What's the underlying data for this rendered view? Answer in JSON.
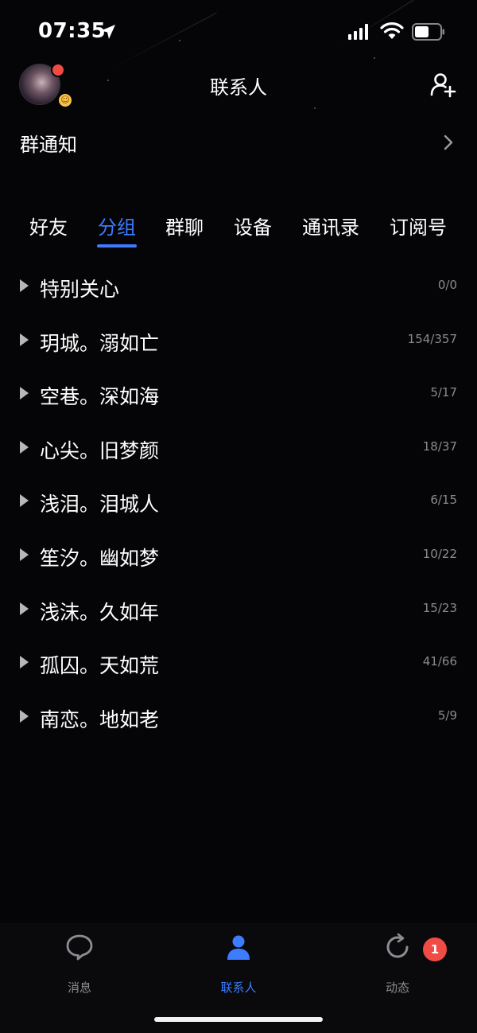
{
  "status_bar": {
    "time": "07:35"
  },
  "header": {
    "title": "联系人"
  },
  "notice": {
    "label": "群通知"
  },
  "tabs": [
    {
      "label": "好友"
    },
    {
      "label": "分组"
    },
    {
      "label": "群聊"
    },
    {
      "label": "设备"
    },
    {
      "label": "通讯录"
    },
    {
      "label": "订阅号"
    }
  ],
  "active_tab": "分组",
  "groups": [
    {
      "name": "特别关心",
      "count": "0/0"
    },
    {
      "name": "玥城。溺如亡",
      "count": "154/357"
    },
    {
      "name": "空巷。深如海",
      "count": "5/17"
    },
    {
      "name": "心尖。旧梦颜",
      "count": "18/37"
    },
    {
      "name": "浅泪。泪城人",
      "count": "6/15"
    },
    {
      "name": "笙汐。幽如梦",
      "count": "10/22"
    },
    {
      "name": "浅沫。久如年",
      "count": "15/23"
    },
    {
      "name": "孤囚。天如荒",
      "count": "41/66"
    },
    {
      "name": "南恋。地如老",
      "count": "5/9"
    }
  ],
  "bottom_nav": [
    {
      "label": "消息",
      "icon": "message-icon"
    },
    {
      "label": "联系人",
      "icon": "contact-icon"
    },
    {
      "label": "动态",
      "icon": "moments-icon",
      "badge": "1"
    }
  ],
  "colors": {
    "accent": "#3d7bff",
    "badge": "#f04b45",
    "background": "#050507"
  }
}
